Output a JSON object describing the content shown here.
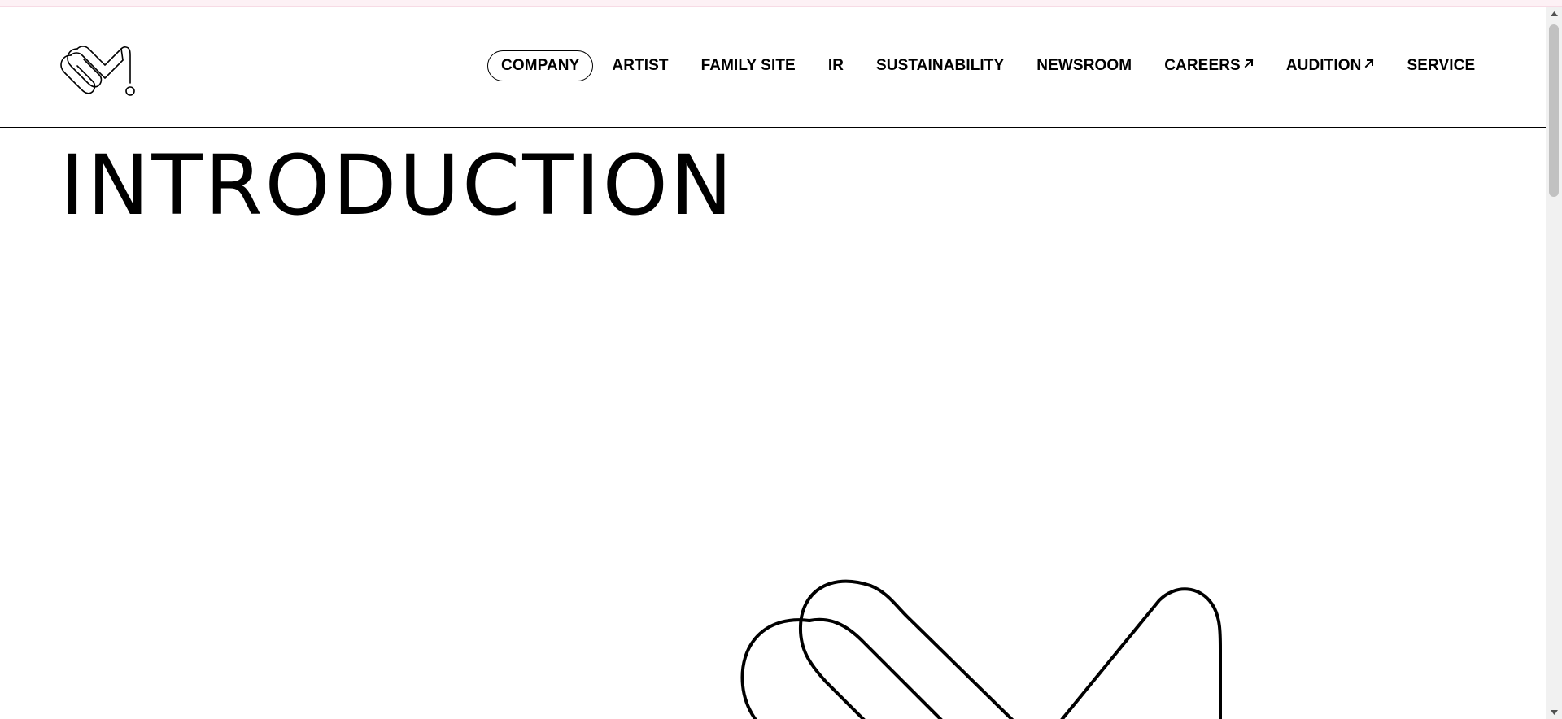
{
  "header": {
    "logo_name": "sm-logo",
    "nav": [
      {
        "label": "COMPANY",
        "active": true,
        "external": false
      },
      {
        "label": "ARTIST",
        "active": false,
        "external": false
      },
      {
        "label": "FAMILY SITE",
        "active": false,
        "external": false
      },
      {
        "label": "IR",
        "active": false,
        "external": false
      },
      {
        "label": "SUSTAINABILITY",
        "active": false,
        "external": false
      },
      {
        "label": "NEWSROOM",
        "active": false,
        "external": false
      },
      {
        "label": "CAREERS",
        "active": false,
        "external": true
      },
      {
        "label": "AUDITION",
        "active": false,
        "external": true
      },
      {
        "label": "SERVICE",
        "active": false,
        "external": false
      }
    ]
  },
  "main": {
    "title": "INTRODUCTION",
    "hero_graphic": "sm-logo-outline"
  },
  "icons": {
    "external_link": "arrow-up-right-icon",
    "scroll_up": "chevron-up-icon",
    "scroll_down": "chevron-down-icon"
  },
  "colors": {
    "text": "#000000",
    "background": "#ffffff",
    "top_strip": "#fdf1f5",
    "scrollbar_track": "#f1f1f1",
    "scrollbar_thumb": "#c1c1c1"
  }
}
